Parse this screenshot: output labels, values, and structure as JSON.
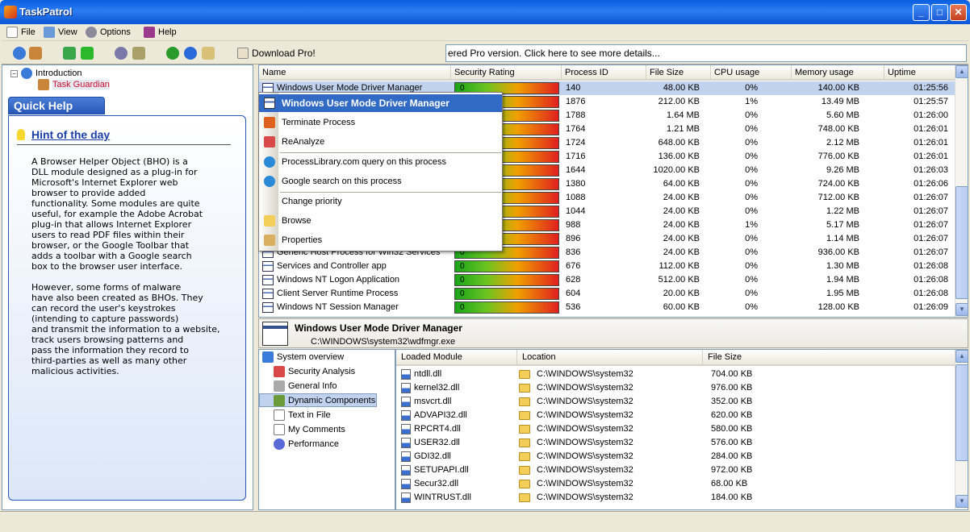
{
  "window": {
    "title": "TaskPatrol"
  },
  "menu": [
    {
      "label": "File",
      "icon": "file-icon"
    },
    {
      "label": "View",
      "icon": "view-icon"
    },
    {
      "label": "Options",
      "icon": "options-icon"
    },
    {
      "label": "Help",
      "icon": "help-book-icon"
    }
  ],
  "toolbar": {
    "download_label": "Download Pro!",
    "promo_text": "ered Pro version. Click here to see more details..."
  },
  "tree": {
    "root": "Introduction",
    "child": "Task Guardian"
  },
  "quick_help": {
    "tab": "Quick Help",
    "hint_title": "Hint of the day",
    "hint_body": "A Browser Helper Object (BHO) is a\nDLL module designed as a plug-in for\nMicrosoft's Internet Explorer web\nbrowser to provide added\nfunctionality. Some modules are quite\nuseful, for example the Adobe Acrobat\nplug-in that allows Internet Explorer\nusers to read PDF files within their\nbrowser, or the Google Toolbar that\nadds a toolbar with a Google search\nbox to the browser user interface.\n\nHowever, some forms of malware\nhave also been created as BHOs. They\ncan record the user's keystrokes\n(intending to capture passwords)\nand transmit the information to a website,\ntrack users browsing patterns and\npass the information they record to\nthird-parties as well as many other\nmalicious activities."
  },
  "process_table": {
    "columns": [
      "Name",
      "Security Rating",
      "Process ID",
      "File Size",
      "CPU usage",
      "Memory usage",
      "Uptime"
    ],
    "rows": [
      {
        "name": "Windows User Mode Driver Manager",
        "rating": "0",
        "pid": "140",
        "size": "48.00 KB",
        "cpu": "0%",
        "mem": "140.00 KB",
        "uptime": "01:25:56"
      },
      {
        "name": "",
        "rating": "",
        "pid": "1876",
        "size": "212.00 KB",
        "cpu": "1%",
        "mem": "13.49 MB",
        "uptime": "01:25:57"
      },
      {
        "name": "",
        "rating": "",
        "pid": "1788",
        "size": "1.64 MB",
        "cpu": "0%",
        "mem": "5.60 MB",
        "uptime": "01:26:00"
      },
      {
        "name": "",
        "rating": "",
        "pid": "1764",
        "size": "1.21 MB",
        "cpu": "0%",
        "mem": "748.00 KB",
        "uptime": "01:26:01"
      },
      {
        "name": "",
        "rating": "",
        "pid": "1724",
        "size": "648.00 KB",
        "cpu": "0%",
        "mem": "2.12 MB",
        "uptime": "01:26:01"
      },
      {
        "name": "",
        "rating": "",
        "pid": "1716",
        "size": "136.00 KB",
        "cpu": "0%",
        "mem": "776.00 KB",
        "uptime": "01:26:01"
      },
      {
        "name": "",
        "rating": "",
        "pid": "1644",
        "size": "1020.00 KB",
        "cpu": "0%",
        "mem": "9.26 MB",
        "uptime": "01:26:03"
      },
      {
        "name": "",
        "rating": "",
        "pid": "1380",
        "size": "64.00 KB",
        "cpu": "0%",
        "mem": "724.00 KB",
        "uptime": "01:26:06"
      },
      {
        "name": "",
        "rating": "",
        "pid": "1088",
        "size": "24.00 KB",
        "cpu": "0%",
        "mem": "712.00 KB",
        "uptime": "01:26:07"
      },
      {
        "name": "",
        "rating": "",
        "pid": "1044",
        "size": "24.00 KB",
        "cpu": "0%",
        "mem": "1.22 MB",
        "uptime": "01:26:07"
      },
      {
        "name": "",
        "rating": "",
        "pid": "988",
        "size": "24.00 KB",
        "cpu": "1%",
        "mem": "5.17 MB",
        "uptime": "01:26:07"
      },
      {
        "name": "",
        "rating": "",
        "pid": "896",
        "size": "24.00 KB",
        "cpu": "0%",
        "mem": "1.14 MB",
        "uptime": "01:26:07"
      },
      {
        "name": "Generic Host Process for Win32 Services",
        "rating": "0",
        "pid": "836",
        "size": "24.00 KB",
        "cpu": "0%",
        "mem": "936.00 KB",
        "uptime": "01:26:07"
      },
      {
        "name": "Services and Controller app",
        "rating": "0",
        "pid": "676",
        "size": "112.00 KB",
        "cpu": "0%",
        "mem": "1.30 MB",
        "uptime": "01:26:08"
      },
      {
        "name": "Windows NT Logon Application",
        "rating": "0",
        "pid": "628",
        "size": "512.00 KB",
        "cpu": "0%",
        "mem": "1.94 MB",
        "uptime": "01:26:08"
      },
      {
        "name": "Client Server Runtime Process",
        "rating": "0",
        "pid": "604",
        "size": "20.00 KB",
        "cpu": "0%",
        "mem": "1.95 MB",
        "uptime": "01:26:08"
      },
      {
        "name": "Windows NT Session Manager",
        "rating": "0",
        "pid": "536",
        "size": "60.00 KB",
        "cpu": "0%",
        "mem": "128.00 KB",
        "uptime": "01:26:09"
      }
    ]
  },
  "context_menu": {
    "title": "Windows User Mode Driver Manager",
    "items": [
      "Terminate Process",
      "ReAnalyze",
      "ProcessLibrary.com query on this process",
      "Google search on this process",
      "Change priority",
      "Browse",
      "Properties"
    ]
  },
  "detail": {
    "name": "Windows User Mode Driver Manager",
    "path": "C:\\WINDOWS\\system32\\wdfmgr.exe"
  },
  "nav": [
    "System overview",
    "Security Analysis",
    "General Info",
    "Dynamic Components",
    "Text in File",
    "My Comments",
    "Performance"
  ],
  "modules": {
    "columns": [
      "Loaded Module",
      "Location",
      "File Size"
    ],
    "rows": [
      {
        "name": "ntdll.dll",
        "loc": "C:\\WINDOWS\\system32",
        "size": "704.00 KB"
      },
      {
        "name": "kernel32.dll",
        "loc": "C:\\WINDOWS\\system32",
        "size": "976.00 KB"
      },
      {
        "name": "msvcrt.dll",
        "loc": "C:\\WINDOWS\\system32",
        "size": "352.00 KB"
      },
      {
        "name": "ADVAPI32.dll",
        "loc": "C:\\WINDOWS\\system32",
        "size": "620.00 KB"
      },
      {
        "name": "RPCRT4.dll",
        "loc": "C:\\WINDOWS\\system32",
        "size": "580.00 KB"
      },
      {
        "name": "USER32.dll",
        "loc": "C:\\WINDOWS\\system32",
        "size": "576.00 KB"
      },
      {
        "name": "GDI32.dll",
        "loc": "C:\\WINDOWS\\system32",
        "size": "284.00 KB"
      },
      {
        "name": "SETUPAPI.dll",
        "loc": "C:\\WINDOWS\\system32",
        "size": "972.00 KB"
      },
      {
        "name": "Secur32.dll",
        "loc": "C:\\WINDOWS\\system32",
        "size": "68.00 KB"
      },
      {
        "name": "WINTRUST.dll",
        "loc": "C:\\WINDOWS\\system32",
        "size": "184.00 KB"
      }
    ]
  }
}
